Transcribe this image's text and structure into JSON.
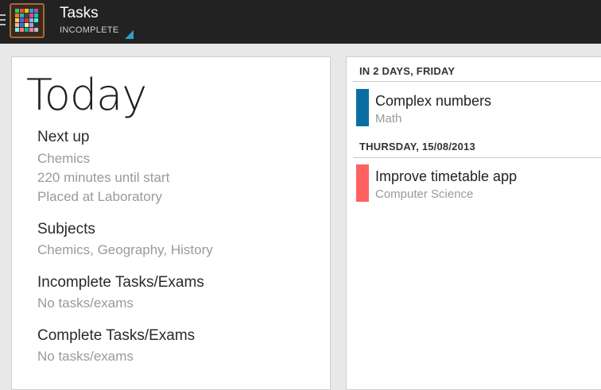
{
  "actionbar": {
    "title": "Tasks",
    "filter": "INCOMPLETE",
    "icon_colors": [
      "#2ecc71",
      "#e74c3c",
      "#f1c40f",
      "#3498db",
      "#9b59b6",
      "#e67e22",
      "#1abc9c",
      "#34495e",
      "#e84393",
      "#00cec9",
      "#fdcb6e",
      "#6c5ce7",
      "#d63031",
      "#74b9ff",
      "#55efc4",
      "#fab1a0",
      "#0984e3",
      "#ffeaa7",
      "#a29bfe",
      "#2d3436",
      "#81ecec",
      "#ff7675",
      "#00b894",
      "#fd79a8",
      "#b2bec3"
    ]
  },
  "left": {
    "heading": "Today",
    "next_up": {
      "label": "Next up",
      "subject": "Chemics",
      "time": "220 minutes until start",
      "place": "Placed at Laboratory"
    },
    "subjects": {
      "label": "Subjects",
      "value": "Chemics, Geography, History"
    },
    "incomplete": {
      "label": "Incomplete Tasks/Exams",
      "value": "No tasks/exams"
    },
    "complete": {
      "label": "Complete Tasks/Exams",
      "value": "No tasks/exams"
    }
  },
  "right": {
    "groups": [
      {
        "header": "IN 2 DAYS, FRIDAY",
        "items": [
          {
            "title": "Complex numbers",
            "subject": "Math",
            "color": "#0b6ea0"
          }
        ]
      },
      {
        "header": "THURSDAY, 15/08/2013",
        "items": [
          {
            "title": "Improve timetable app",
            "subject": "Computer Science",
            "color": "#ff6161"
          }
        ]
      }
    ]
  }
}
